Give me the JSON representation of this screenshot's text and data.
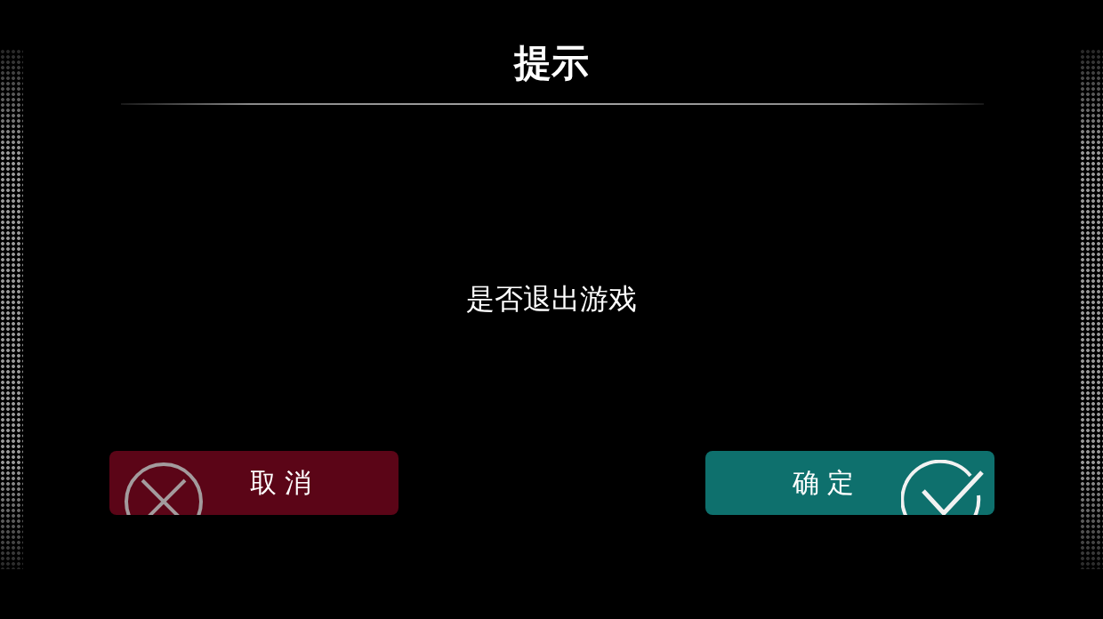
{
  "dialog": {
    "title": "提示",
    "message": "是否退出游戏",
    "buttons": [
      {
        "kind": "cancel",
        "label": "取消"
      },
      {
        "kind": "confirm",
        "label": "确定"
      }
    ]
  }
}
